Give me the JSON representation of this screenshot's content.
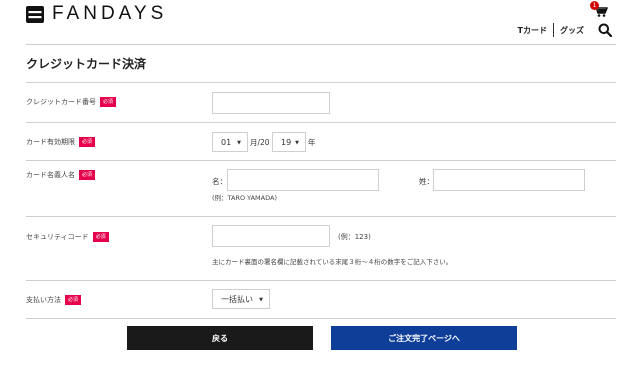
{
  "header": {
    "brand": "FANDAYS",
    "cart_count": "1",
    "nav": [
      {
        "label": "Tカード"
      },
      {
        "label": "グッズ"
      }
    ]
  },
  "page": {
    "title": "クレジットカード決済"
  },
  "form": {
    "required_badge": "必須",
    "card_number": {
      "label": "クレジットカード番号",
      "value": ""
    },
    "expiry": {
      "label": "カード有効期限",
      "month_value": "01",
      "month_suffix": "月/20",
      "year_value": "19",
      "year_suffix": "年"
    },
    "name": {
      "label": "カード名義人名",
      "first_label": "名：",
      "last_label": "姓：",
      "example": "(例：TARO YAMADA)"
    },
    "security": {
      "label": "セキュリティコード",
      "example": "(例：123)",
      "note": "主にカード裏面の署名欄に記載されている末尾３桁～４桁の数字をご記入下さい。"
    },
    "payment": {
      "label": "支払い方法",
      "value": "一括払い"
    }
  },
  "actions": {
    "back_label": "戻る",
    "next_label": "ご注文完了ページへ"
  },
  "colors": {
    "required": "#e6004c",
    "primary_button": "#0f3e99",
    "back_button": "#1a1a1a",
    "badge": "#d10000"
  }
}
